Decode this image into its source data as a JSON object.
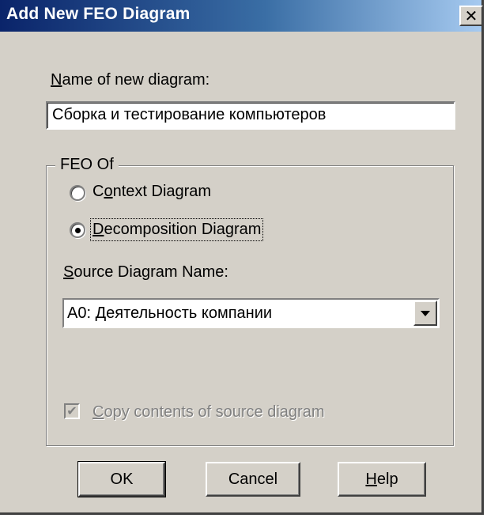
{
  "window": {
    "title": "Add New FEO Diagram",
    "close_glyph": "✕"
  },
  "name_field": {
    "label_mnemonic": "N",
    "label_rest": "ame of new diagram:",
    "value": "Сборка и тестирование компьютеров"
  },
  "feo_group": {
    "legend": "FEO Of",
    "options": [
      {
        "label_pre": "C",
        "label_mnemonic": "o",
        "label_post": "ntext Diagram",
        "selected": false
      },
      {
        "label_pre": "",
        "label_mnemonic": "D",
        "label_post": "ecomposition Diagram",
        "selected": true
      }
    ],
    "source_label_mnemonic": "S",
    "source_label_rest": "ource Diagram Name:",
    "source_value": "A0:  Деятельность компании",
    "copy_checkbox": {
      "label_mnemonic": "C",
      "label_rest": "opy contents of source diagram",
      "checked": true,
      "enabled": false,
      "check_glyph": "✔"
    }
  },
  "buttons": {
    "ok": "OK",
    "cancel": "Cancel",
    "help_mnemonic": "H",
    "help_rest": "elp"
  },
  "colors": {
    "face": "#d4d0c8",
    "title_start": "#0a246a",
    "title_end": "#a6caf0"
  }
}
